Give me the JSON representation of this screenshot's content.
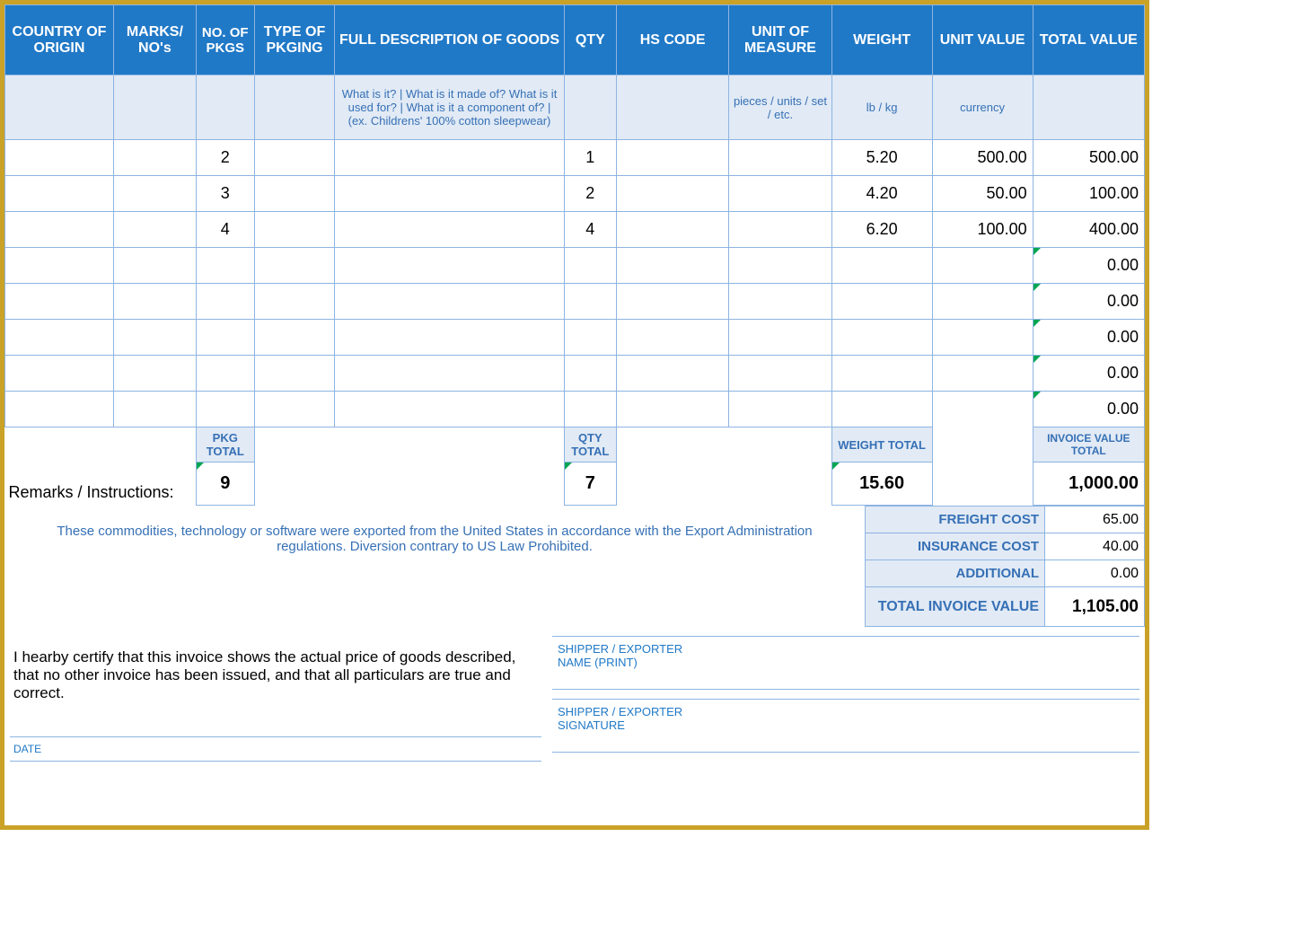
{
  "headers": {
    "country": "COUNTRY OF ORIGIN",
    "marks": "MARKS/ NO's",
    "pkgs": "NO. OF PKGS",
    "pkging": "TYPE OF PKGING",
    "desc": "FULL DESCRIPTION OF GOODS",
    "qty": "QTY",
    "hs": "HS CODE",
    "uom": "UNIT OF MEASURE",
    "weight": "WEIGHT",
    "unitval": "UNIT VALUE",
    "totalval": "TOTAL VALUE"
  },
  "hints": {
    "desc": "What is it? | What is it made of? What is it used for? | What is it a component of? | (ex. Childrens' 100% cotton sleepwear)",
    "uom": "pieces / units / set / etc.",
    "weight": "lb / kg",
    "unitval": "currency"
  },
  "rows": [
    {
      "pkgs": "2",
      "qty": "1",
      "weight": "5.20",
      "unitval": "500.00",
      "totalval": "500.00"
    },
    {
      "pkgs": "3",
      "qty": "2",
      "weight": "4.20",
      "unitval": "50.00",
      "totalval": "100.00"
    },
    {
      "pkgs": "4",
      "qty": "4",
      "weight": "6.20",
      "unitval": "100.00",
      "totalval": "400.00"
    },
    {
      "pkgs": "",
      "qty": "",
      "weight": "",
      "unitval": "",
      "totalval": "0.00"
    },
    {
      "pkgs": "",
      "qty": "",
      "weight": "",
      "unitval": "",
      "totalval": "0.00"
    },
    {
      "pkgs": "",
      "qty": "",
      "weight": "",
      "unitval": "",
      "totalval": "0.00"
    },
    {
      "pkgs": "",
      "qty": "",
      "weight": "",
      "unitval": "",
      "totalval": "0.00"
    },
    {
      "pkgs": "",
      "qty": "",
      "weight": "",
      "unitval": "",
      "totalval": "0.00"
    }
  ],
  "totals": {
    "pkg_label": "PKG TOTAL",
    "qty_label": "QTY TOTAL",
    "weight_label": "WEIGHT TOTAL",
    "invoice_label": "INVOICE VALUE TOTAL",
    "pkg": "9",
    "qty": "7",
    "weight": "15.60",
    "invoice": "1,000.00"
  },
  "remarks_label": "Remarks / Instructions:",
  "costs": {
    "freight_label": "FREIGHT COST",
    "freight": "65.00",
    "insurance_label": "INSURANCE COST",
    "insurance": "40.00",
    "additional_label": "ADDITIONAL",
    "additional": "0.00",
    "total_label": "TOTAL INVOICE VALUE",
    "total": "1,105.00"
  },
  "export_note": "These commodities, technology or software were exported from the United States in accordance with the Export Administration regulations.  Diversion contrary to US Law Prohibited.",
  "cert": "I hearby certify that this invoice shows the actual price of goods described, that no other invoice has been issued, and that all particulars are true and correct.",
  "sig": {
    "name_label1": "SHIPPER / EXPORTER",
    "name_label2": "NAME (PRINT)",
    "sig_label1": "SHIPPER / EXPORTER",
    "sig_label2": "SIGNATURE",
    "date_label": "DATE"
  }
}
